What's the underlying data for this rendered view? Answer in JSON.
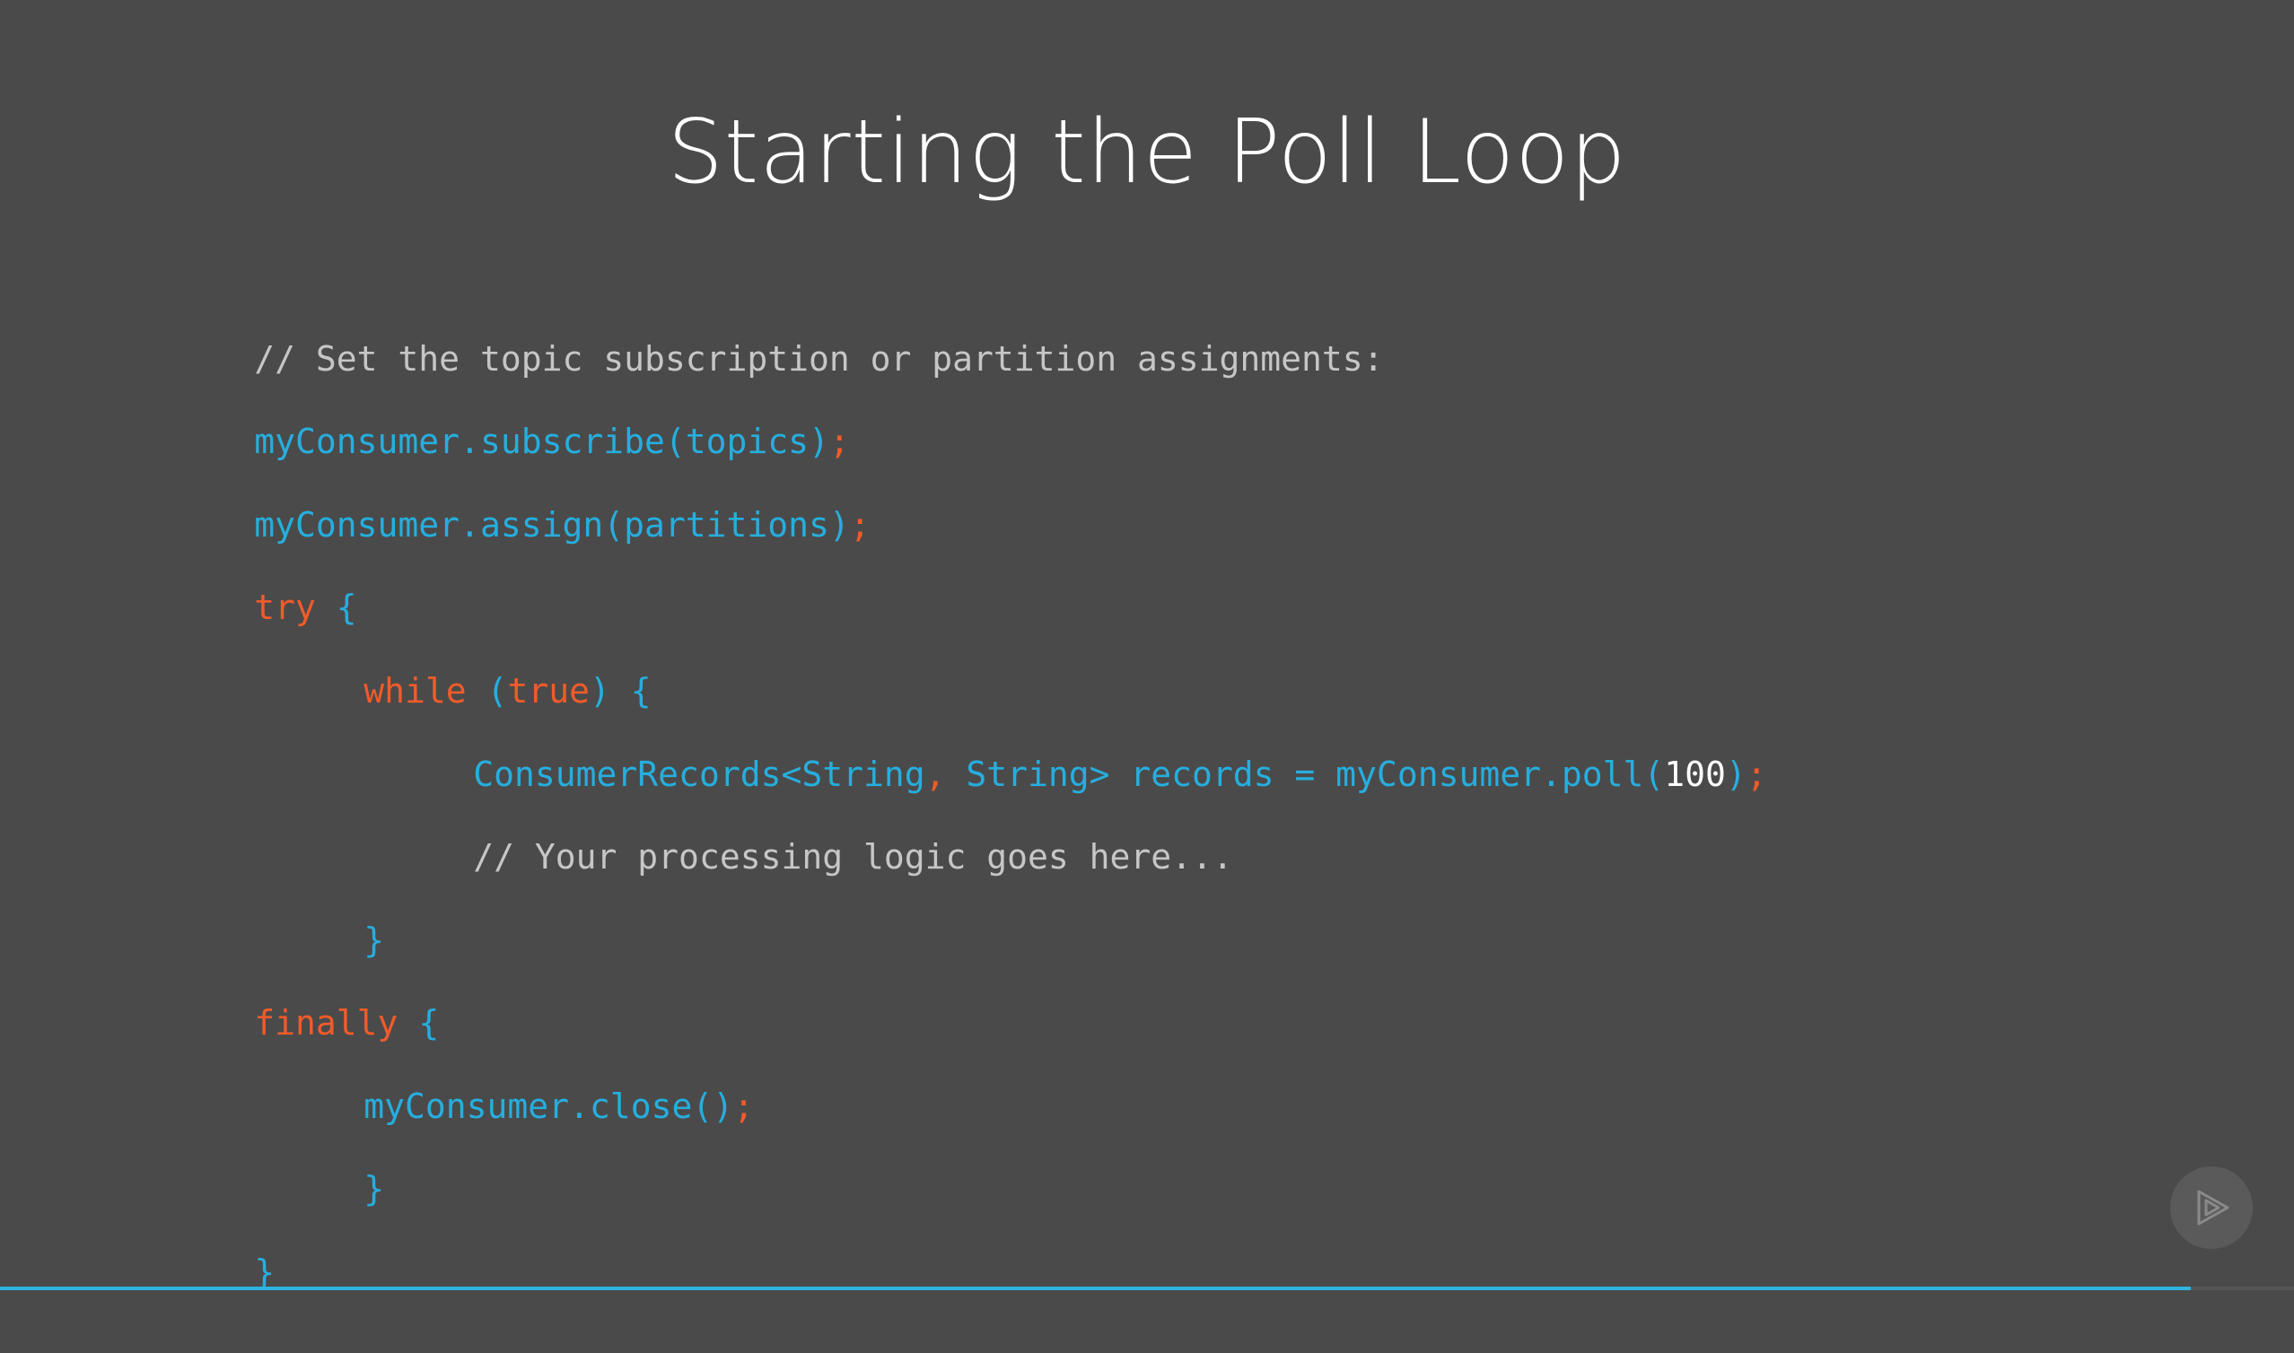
{
  "slide": {
    "title": "Starting the Poll Loop"
  },
  "code": {
    "l1_comment": "// Set the topic subscription or partition assignments:",
    "l2_call": "myConsumer.subscribe(topics)",
    "l2_semi": ";",
    "l3_call": "myConsumer.assign(partitions)",
    "l3_semi": ";",
    "l4_kw": "try",
    "l4_brace": " {",
    "l5_kw": "while",
    "l5_p1": " (",
    "l5_kw2": "true",
    "l5_p2": ") {",
    "l6_a": "ConsumerRecords<String",
    "l6_comma": ",",
    "l6_b": " String> records = myConsumer.poll(",
    "l6_num": "100",
    "l6_c": ")",
    "l6_semi": ";",
    "l7_comment": "// Your processing logic goes here...",
    "l8_brace": "}",
    "l9_kw": "finally",
    "l9_brace": " {",
    "l10_call": "myConsumer.close()",
    "l10_semi": ";",
    "l11_brace": "}",
    "l12_brace": "}"
  },
  "player": {
    "logo_icon": "play-logo-icon",
    "progress": 0.955,
    "accent_color": "#2fb3e0"
  },
  "colors": {
    "background": "#4a4a4a",
    "keyword": "#f15b2a",
    "identifier": "#26aede",
    "comment": "#c6c6c6"
  }
}
